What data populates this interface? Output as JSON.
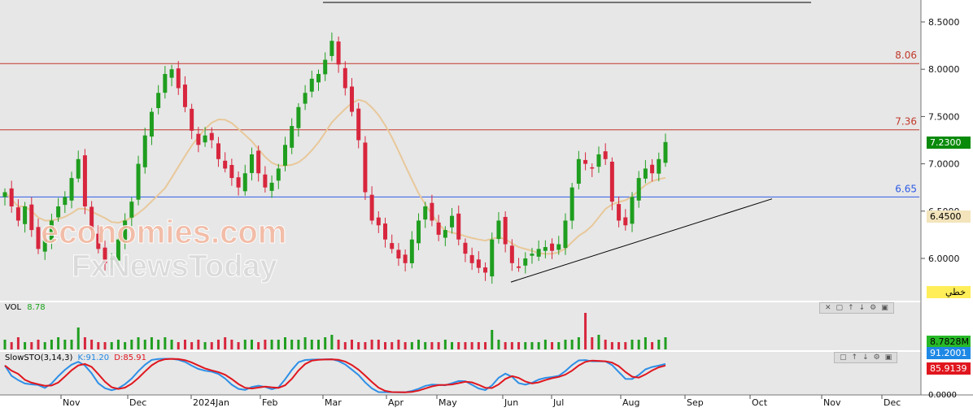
{
  "chart_data": {
    "type": "candlestick",
    "price_axis": {
      "ticks": [
        "8.5000",
        "8.0000",
        "7.5000",
        "7.0000",
        "6.5000",
        "6.0000"
      ],
      "ylim": [
        5.68,
        8.64
      ]
    },
    "x_axis": {
      "ticks": [
        "Nov",
        "Dec",
        "2024Jan",
        "Feb",
        "Mar",
        "Apr",
        "May",
        "Jun",
        "Jul",
        "Aug",
        "Sep",
        "Oct",
        "Nov",
        "Dec"
      ]
    },
    "horizontal_lines": [
      {
        "label": "8.06",
        "value": 8.06,
        "color": "#c0392b"
      },
      {
        "label": "7.36",
        "value": 7.36,
        "color": "#c0392b"
      },
      {
        "label": "6.65",
        "value": 6.65,
        "color": "#2e5ce6"
      }
    ],
    "trendline": {
      "from": [
        "Jun",
        5.75
      ],
      "to": [
        "Oct",
        6.63
      ],
      "color": "#000000"
    },
    "moving_average_color": "#e8c89a",
    "current_price": "7.2300",
    "other_price": "6.4500",
    "button_label": "خطي",
    "approx_closes": [
      6.7,
      6.55,
      6.4,
      6.55,
      6.3,
      6.1,
      6.2,
      6.4,
      6.55,
      6.65,
      6.85,
      7.05,
      6.55,
      6.3,
      6.1,
      5.95,
      6.0,
      6.2,
      6.4,
      6.6,
      7.0,
      7.3,
      7.55,
      7.75,
      7.95,
      8.0,
      7.8,
      7.6,
      7.35,
      7.2,
      7.3,
      7.25,
      7.05,
      6.95,
      6.85,
      6.75,
      6.9,
      7.1,
      6.9,
      6.75,
      6.8,
      6.95,
      7.2,
      7.4,
      7.6,
      7.75,
      7.9,
      7.95,
      8.1,
      8.3,
      8.05,
      7.8,
      7.55,
      7.25,
      6.7,
      6.4,
      6.35,
      6.2,
      6.1,
      6.0,
      5.95,
      6.2,
      6.4,
      6.55,
      6.4,
      6.25,
      6.3,
      6.45,
      6.2,
      6.05,
      5.95,
      5.9,
      5.85,
      6.2,
      6.4,
      6.15,
      5.95,
      5.9,
      6.0,
      6.05,
      6.1,
      6.12,
      6.08,
      6.15,
      6.4,
      6.75,
      7.05,
      7.0,
      6.95,
      7.1,
      7.05,
      6.6,
      6.4,
      6.35,
      6.65,
      6.85,
      6.95,
      6.9,
      7.05,
      7.23
    ],
    "volume": {
      "label": "VOL",
      "value": "8.78",
      "box_value": "8.7828M",
      "approx_values": [
        4,
        3,
        5,
        3,
        3,
        4,
        3,
        4,
        5,
        4,
        4,
        9,
        5,
        4,
        3,
        3,
        3,
        4,
        3,
        4,
        5,
        4,
        5,
        4,
        5,
        4,
        3,
        4,
        3,
        4,
        3,
        3,
        4,
        5,
        4,
        3,
        4,
        4,
        3,
        4,
        4,
        4,
        5,
        4,
        4,
        5,
        4,
        4,
        5,
        6,
        4,
        3,
        4,
        3,
        3,
        4,
        4,
        3,
        3,
        4,
        3,
        3,
        4,
        3,
        3,
        3,
        4,
        3,
        3,
        3,
        3,
        3,
        3,
        8,
        4,
        3,
        3,
        3,
        3,
        3,
        3,
        4,
        3,
        3,
        4,
        4,
        5,
        15,
        5,
        6,
        4,
        3,
        3,
        3,
        4,
        4,
        5,
        3,
        4,
        5
      ]
    },
    "stochastic": {
      "label": "SlowSTO(3,14,3)",
      "k_label": "K:91.20",
      "d_label": "D:85.91",
      "k_box": "91.2001",
      "d_box": "85.9139",
      "axis_tick": "0.0000",
      "k_color": "#2e8fe6",
      "d_color": "#e0161e"
    }
  }
}
